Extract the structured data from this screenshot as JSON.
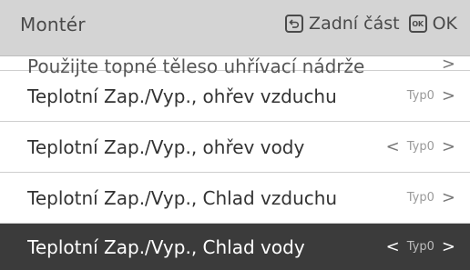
{
  "header": {
    "title": "Montér",
    "back_label": "Zadní část",
    "ok_label": "OK",
    "ok_icon_text": "OK"
  },
  "list": {
    "items": [
      {
        "label": "Použijte topné těleso uhřívací nádrže",
        "value": "",
        "left_chevron": "",
        "right_chevron": ">"
      },
      {
        "label": "Teplotní Zap./Vyp., ohřev vzduchu",
        "value": "Typ0",
        "left_chevron": "",
        "right_chevron": ">"
      },
      {
        "label": "Teplotní Zap./Vyp., ohřev vody",
        "value": "Typ0",
        "left_chevron": "<",
        "right_chevron": ">"
      },
      {
        "label": "Teplotní Zap./Vyp., Chlad vzduchu",
        "value": "Typ0",
        "left_chevron": "",
        "right_chevron": ">"
      },
      {
        "label": "Teplotní Zap./Vyp., Chlad vody",
        "value": "Typ0",
        "left_chevron": "<",
        "right_chevron": ">"
      }
    ]
  },
  "icons": {
    "back": "back-arrow-icon",
    "ok": "ok-button-icon"
  },
  "colors": {
    "header_bg": "#d4d4d4",
    "selected_bg": "#3b3b3b",
    "text": "#333333"
  }
}
